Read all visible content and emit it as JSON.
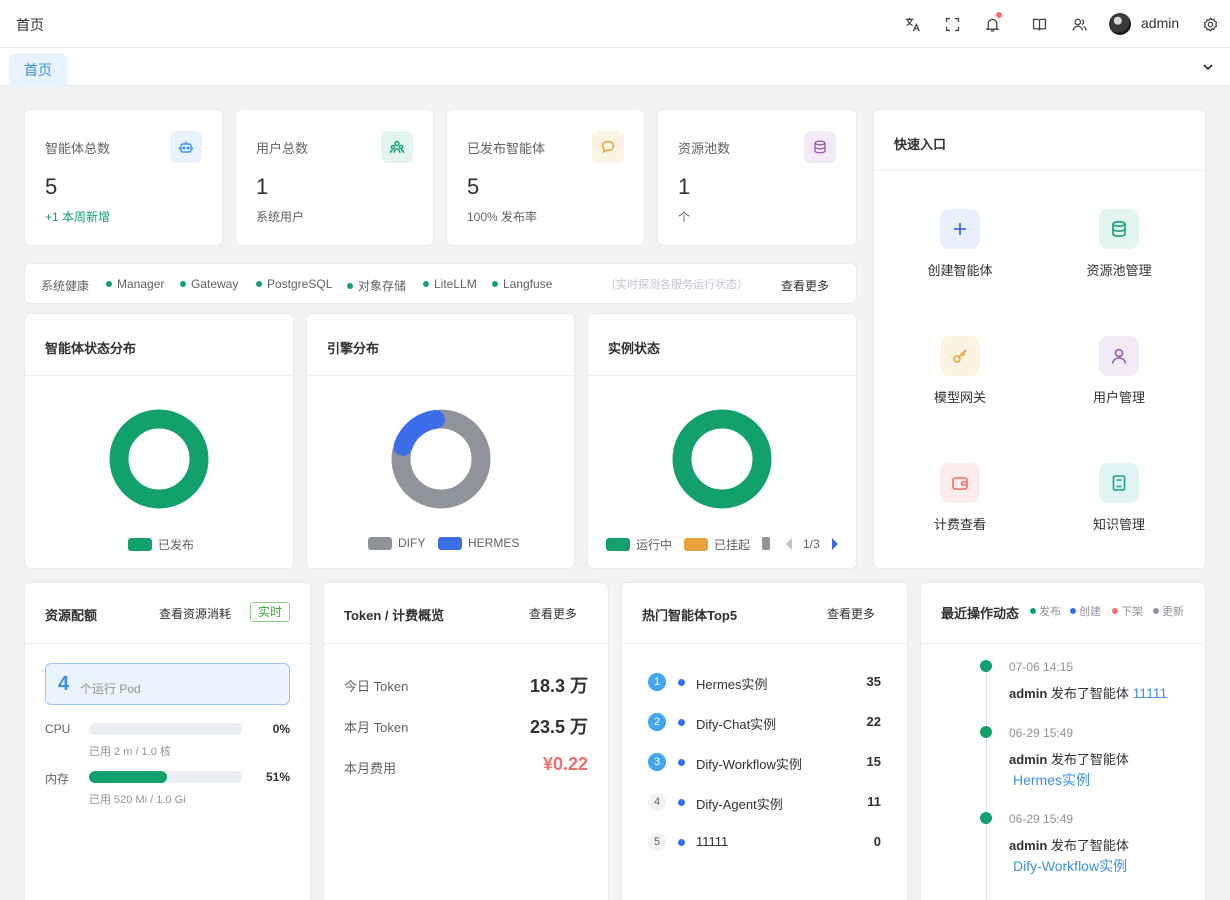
{
  "header": {
    "breadcrumb": "首页",
    "username": "admin"
  },
  "tabs": [
    {
      "label": "首页"
    }
  ],
  "stats": [
    {
      "label": "智能体总数",
      "value": "5",
      "sub": "+1 本周新增",
      "icon": "robot-icon",
      "color": "#3b8fe8"
    },
    {
      "label": "用户总数",
      "value": "1",
      "sub": "系统用户",
      "icon": "users-icon",
      "color": "#12a16d"
    },
    {
      "label": "已发布智能体",
      "value": "5",
      "sub": "100% 发布率",
      "icon": "chat-icon",
      "color": "#e6a23c"
    },
    {
      "label": "资源池数",
      "value": "1",
      "sub": "个",
      "icon": "database-icon",
      "color": "#9b59b6"
    }
  ],
  "health": {
    "label": "系统健康",
    "services": [
      "Manager",
      "Gateway",
      "PostgreSQL",
      "对象存储",
      "LiteLLM",
      "Langfuse"
    ],
    "note": "（实时探测各服务运行状态）",
    "more": "查看更多"
  },
  "quick": {
    "title": "快速入口",
    "items": [
      {
        "label": "创建智能体",
        "icon": "plus-icon"
      },
      {
        "label": "资源池管理",
        "icon": "database-icon"
      },
      {
        "label": "模型网关",
        "icon": "key-icon"
      },
      {
        "label": "用户管理",
        "icon": "user-icon"
      },
      {
        "label": "计费查看",
        "icon": "wallet-icon"
      },
      {
        "label": "知识管理",
        "icon": "book-icon"
      }
    ]
  },
  "charts": {
    "status": {
      "title": "智能体状态分布",
      "legend": [
        "已发布"
      ]
    },
    "engine": {
      "title": "引擎分布",
      "legend": [
        "DIFY",
        "HERMES"
      ]
    },
    "instance": {
      "title": "实例状态",
      "legend": [
        "运行中",
        "已挂起"
      ],
      "pager": "1/3"
    }
  },
  "chart_data": [
    {
      "type": "pie",
      "title": "智能体状态分布",
      "categories": [
        "已发布"
      ],
      "values": [
        5
      ],
      "colors": [
        "#12a16d"
      ]
    },
    {
      "type": "pie",
      "title": "引擎分布",
      "categories": [
        "DIFY",
        "HERMES"
      ],
      "values": [
        4,
        1
      ],
      "colors": [
        "#909399",
        "#3b6ee8"
      ]
    },
    {
      "type": "pie",
      "title": "实例状态",
      "categories": [
        "运行中"
      ],
      "values": [
        1
      ],
      "colors": [
        "#12a16d"
      ]
    }
  ],
  "resources": {
    "title": "资源配额",
    "link": "查看资源消耗",
    "tag": "实时",
    "pods": "4",
    "pods_label": "个运行 Pod",
    "cpu": {
      "label": "CPU",
      "pct": "0%",
      "fraction": 0.0,
      "sub": "已用 2 m / 1.0 核"
    },
    "mem": {
      "label": "内存",
      "pct": "51%",
      "fraction": 0.51,
      "sub": "已用 520 Mi / 1.0 Gi"
    }
  },
  "token": {
    "title": "Token / 计费概览",
    "more": "查看更多",
    "rows": [
      {
        "k": "今日 Token",
        "v": "18.3 万"
      },
      {
        "k": "本月 Token",
        "v": "23.5 万"
      },
      {
        "k": "本月费用",
        "v": "¥0.22"
      }
    ]
  },
  "top5": {
    "title": "热门智能体Top5",
    "more": "查看更多",
    "rows": [
      {
        "rank": "1",
        "name": "Hermes实例",
        "count": "35"
      },
      {
        "rank": "2",
        "name": "Dify-Chat实例",
        "count": "22"
      },
      {
        "rank": "3",
        "name": "Dify-Workflow实例",
        "count": "15"
      },
      {
        "rank": "4",
        "name": "Dify-Agent实例",
        "count": "11"
      },
      {
        "rank": "5",
        "name": "11111",
        "count": "0"
      }
    ]
  },
  "activity": {
    "title": "最近操作动态",
    "legend": [
      "发布",
      "创建",
      "下架",
      "更新"
    ],
    "items": [
      {
        "time": "07-06 14:15",
        "user": "admin",
        "action": "发布了智能体",
        "target": "11111"
      },
      {
        "time": "06-29 15:49",
        "user": "admin",
        "action": "发布了智能体",
        "target": "Hermes实例"
      },
      {
        "time": "06-29 15:49",
        "user": "admin",
        "action": "发布了智能体",
        "target": "Dify-Workflow实例"
      }
    ]
  }
}
